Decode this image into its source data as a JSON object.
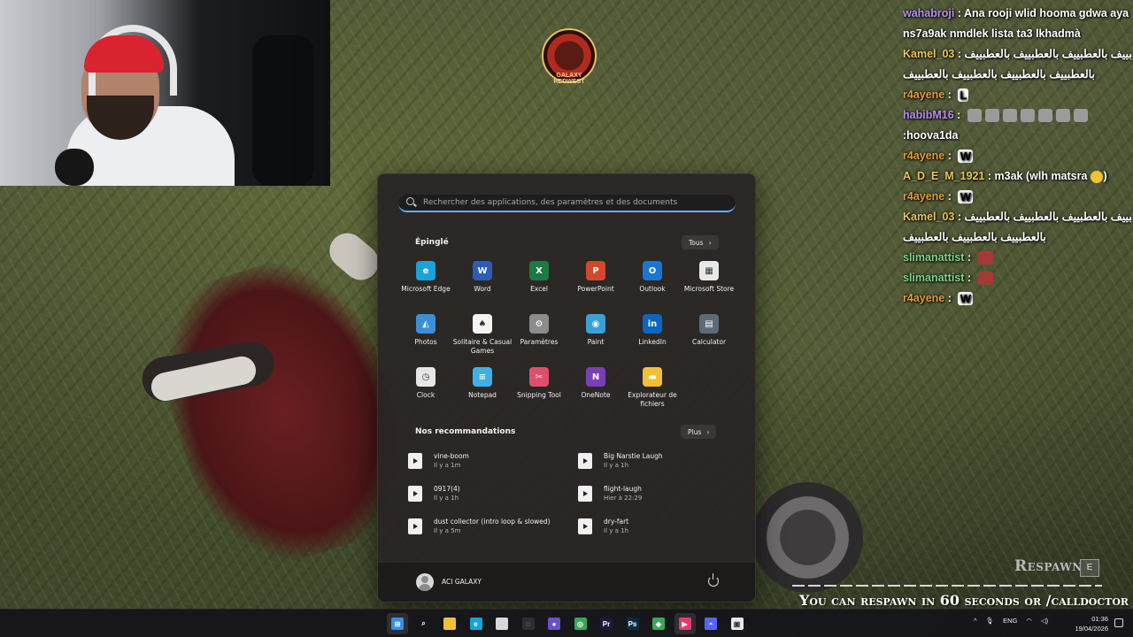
{
  "stream": {
    "logo_text": "GALAXY REDWEST",
    "chat": [
      {
        "user": "wahabroji",
        "user_color": "#b98cf0",
        "message": "Ana rooji wlid hooma gdwa aya"
      },
      {
        "user": "",
        "user_color": "#ffffff",
        "message": "ns7a9ak nmdlek lista ta3 lkhadmà"
      },
      {
        "user": "Kamel_03",
        "user_color": "#e9c35c",
        "message": "بالعطبييف بالعطبييف بالعطبييف بالعطبييف"
      },
      {
        "user": "",
        "user_color": "#ffffff",
        "message": "بالعطبييف بالعطبييف بالعطبييف بالعطبييف"
      },
      {
        "user": "r4ayene",
        "user_color": "#e39a3c",
        "message": "",
        "emote": "L"
      },
      {
        "user": "habibM16",
        "user_color": "#b98cf0",
        "message": "",
        "emote": "faces"
      },
      {
        "user": "",
        "user_color": "#ffffff",
        "message": ":hoova1da"
      },
      {
        "user": "r4ayene",
        "user_color": "#e39a3c",
        "message": "",
        "emote": "W"
      },
      {
        "user": "A_D_E_M_1921",
        "user_color": "#e9c35c",
        "message": "m3ak (wlh matsra",
        "emote": "laugh"
      },
      {
        "user": "r4ayene",
        "user_color": "#e39a3c",
        "message": "",
        "emote": "W"
      },
      {
        "user": "Kamel_03",
        "user_color": "#e9c35c",
        "message": "بالعطبييف بالعطبييف بالعطبييف بالعطبييف"
      },
      {
        "user": "",
        "user_color": "#ffffff",
        "message": "بالعطبييف بالعطبييف بالعطبييف"
      },
      {
        "user": "slimanattist",
        "user_color": "#7fd48a",
        "message": "",
        "emote": "red"
      },
      {
        "user": "slimanattist",
        "user_color": "#7fd48a",
        "message": "",
        "emote": "red"
      },
      {
        "user": "r4ayene",
        "user_color": "#e39a3c",
        "message": "",
        "emote": "W"
      }
    ],
    "respawn_label": "Respawn",
    "respawn_key": "E",
    "respawn_message": "You can respawn in 60 seconds or  /calldoctor"
  },
  "start_menu": {
    "search_placeholder": "Rechercher des applications, des paramètres et des documents",
    "pinned_title": "Épinglé",
    "all_button": "Tous",
    "apps": [
      {
        "label": "Microsoft Edge",
        "icon": "edge-icon",
        "color": "#1aa3d9",
        "glyph": "e"
      },
      {
        "label": "Word",
        "icon": "word-icon",
        "color": "#2b5cb8",
        "glyph": "W"
      },
      {
        "label": "Excel",
        "icon": "excel-icon",
        "color": "#1d7a43",
        "glyph": "X"
      },
      {
        "label": "PowerPoint",
        "icon": "powerpoint-icon",
        "color": "#d3472b",
        "glyph": "P"
      },
      {
        "label": "Outlook",
        "icon": "outlook-icon",
        "color": "#1976d2",
        "glyph": "O"
      },
      {
        "label": "Microsoft Store",
        "icon": "store-icon",
        "color": "#e8e8e8",
        "glyph": "▦"
      },
      {
        "label": "Photos",
        "icon": "photos-icon",
        "color": "#3a8fd6",
        "glyph": "◭"
      },
      {
        "label": "Solitaire & Casual Games",
        "icon": "solitaire-icon",
        "color": "#f4f4f4",
        "glyph": "♠"
      },
      {
        "label": "Paramètres",
        "icon": "settings-icon",
        "color": "#8c8c8c",
        "glyph": "⚙"
      },
      {
        "label": "Paint",
        "icon": "paint-icon",
        "color": "#3aa0d8",
        "glyph": "◉"
      },
      {
        "label": "LinkedIn",
        "icon": "linkedin-icon",
        "color": "#0a66c2",
        "glyph": "in"
      },
      {
        "label": "Calculator",
        "icon": "calculator-icon",
        "color": "#5b6b7a",
        "glyph": "▤"
      },
      {
        "label": "Clock",
        "icon": "clock-icon",
        "color": "#e6e6e6",
        "glyph": "◷"
      },
      {
        "label": "Notepad",
        "icon": "notepad-icon",
        "color": "#3fb0e6",
        "glyph": "≡"
      },
      {
        "label": "Snipping Tool",
        "icon": "snipping-tool-icon",
        "color": "#e04f6a",
        "glyph": "✂"
      },
      {
        "label": "OneNote",
        "icon": "onenote-icon",
        "color": "#7a3fb5",
        "glyph": "N"
      },
      {
        "label": "Explorateur de fichiers",
        "icon": "file-explorer-icon",
        "color": "#f2c037",
        "glyph": "▬"
      }
    ],
    "recommendations_title": "Nos recommandations",
    "more_button": "Plus",
    "recommendations": [
      {
        "name": "vine-boom",
        "time": "Il y a 1m"
      },
      {
        "name": "Big Narstie Laugh",
        "time": "Il y a 1h"
      },
      {
        "name": "0917(4)",
        "time": "Il y a 1h"
      },
      {
        "name": "flight-laugh",
        "time": "Hier à 22:29"
      },
      {
        "name": "dust collector (intro loop & slowed)",
        "time": "Il y a 5m"
      },
      {
        "name": "dry-fart",
        "time": "Il y a 1h"
      }
    ],
    "user_name": "ACI GALAXY"
  },
  "taskbar": {
    "apps": [
      {
        "name": "start-button",
        "color": "#3a8fe6",
        "glyph": "⊞",
        "active": true
      },
      {
        "name": "search-icon",
        "color": "#00000000",
        "glyph": "⌕",
        "active": false
      },
      {
        "name": "file-explorer-icon",
        "color": "#f2c037",
        "glyph": "",
        "active": false
      },
      {
        "name": "edge-icon",
        "color": "#1aa3d9",
        "glyph": "e",
        "active": false
      },
      {
        "name": "store-icon",
        "color": "#d8d8d8",
        "glyph": "",
        "active": false
      },
      {
        "name": "app-icon-1",
        "color": "#2e2e2e",
        "glyph": "◌",
        "active": false
      },
      {
        "name": "app-icon-2",
        "color": "#6a4fc7",
        "glyph": "●",
        "active": false
      },
      {
        "name": "chrome-icon",
        "color": "#3aa657",
        "glyph": "◎",
        "active": false
      },
      {
        "name": "premiere-icon",
        "color": "#1b1a3f",
        "glyph": "Pr",
        "active": false
      },
      {
        "name": "photoshop-icon",
        "color": "#0a2a44",
        "glyph": "Ps",
        "active": false
      },
      {
        "name": "app-icon-3",
        "color": "#3aa657",
        "glyph": "◆",
        "active": false
      },
      {
        "name": "media-player-icon",
        "color": "#e23b6a",
        "glyph": "▶",
        "active": true
      },
      {
        "name": "discord-icon",
        "color": "#5865f2",
        "glyph": "◓",
        "active": false
      },
      {
        "name": "app-icon-4",
        "color": "#e8e8e8",
        "glyph": "▣",
        "active": false
      }
    ],
    "language": "ENG",
    "time": "01:36",
    "date": "19/04/2026"
  }
}
